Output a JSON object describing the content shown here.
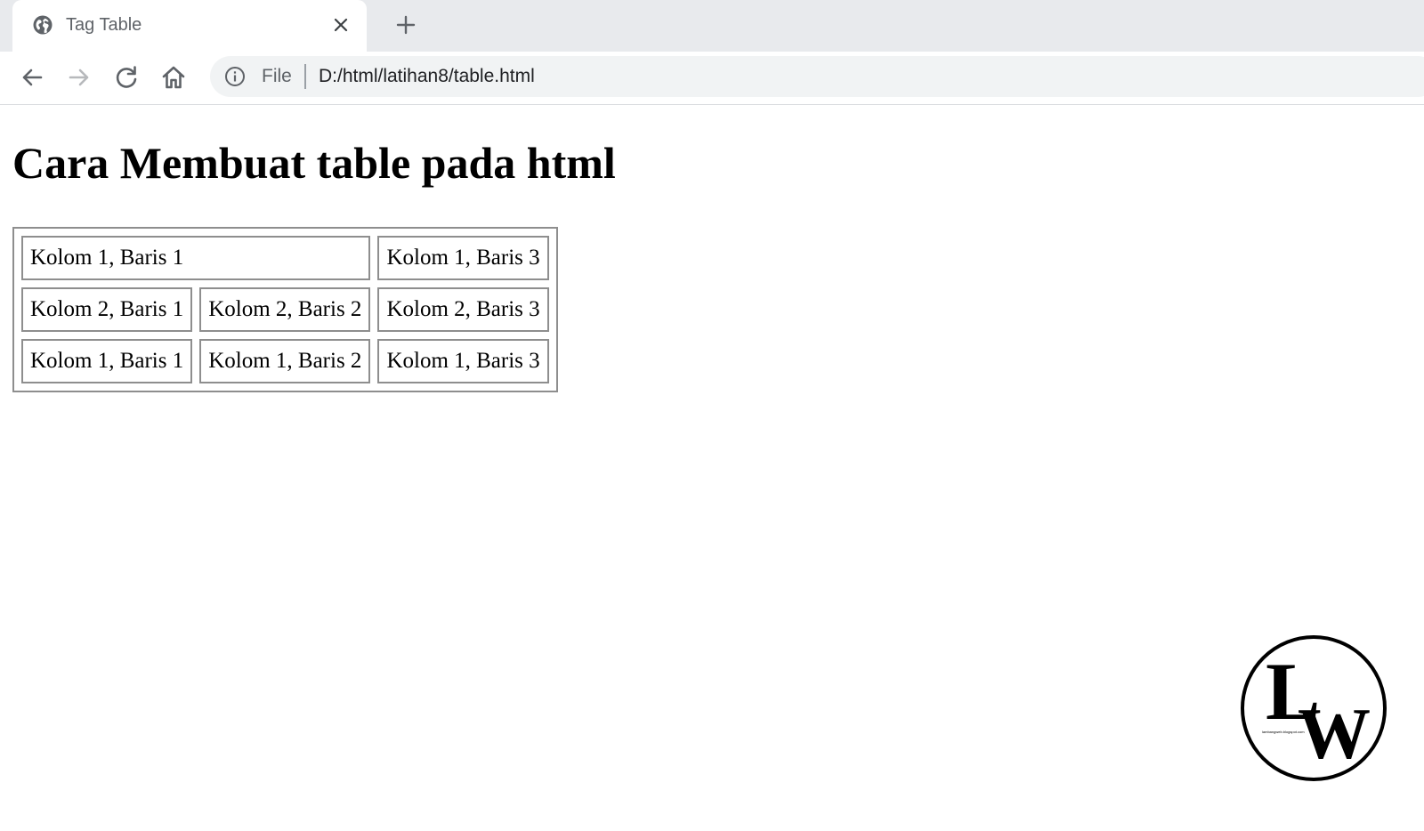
{
  "browser": {
    "tab": {
      "title": "Tag Table",
      "favicon": "globe-icon"
    },
    "new_tab_icon": "plus-icon",
    "nav": {
      "back_icon": "arrow-left-icon",
      "forward_icon": "arrow-right-icon",
      "reload_icon": "reload-icon",
      "home_icon": "home-icon"
    },
    "omnibox": {
      "info_icon": "info-icon",
      "scheme_label": "File",
      "url": "D:/html/latihan8/table.html"
    }
  },
  "page": {
    "heading": "Cara Membuat table pada html",
    "table": {
      "rows": [
        {
          "cells": [
            {
              "text": "Kolom 1, Baris 1",
              "colspan": 2
            },
            {
              "text": "Kolom 1, Baris 3"
            }
          ]
        },
        {
          "cells": [
            {
              "text": "Kolom 2, Baris 1"
            },
            {
              "text": "Kolom 2, Baris 2"
            },
            {
              "text": "Kolom 2, Baris 3"
            }
          ]
        },
        {
          "cells": [
            {
              "text": "Kolom 1, Baris 1"
            },
            {
              "text": "Kolom 1, Baris 2"
            },
            {
              "text": "Kolom 1, Baris 3"
            }
          ]
        }
      ]
    },
    "watermark": {
      "letters": "LW",
      "caption": "lambangweb.blogspot.com"
    }
  },
  "colors": {
    "tabstrip_bg": "#e8eaed",
    "omnibox_bg": "#f1f3f4",
    "icon_gray": "#5f6368",
    "table_border": "#8e8e8e"
  }
}
